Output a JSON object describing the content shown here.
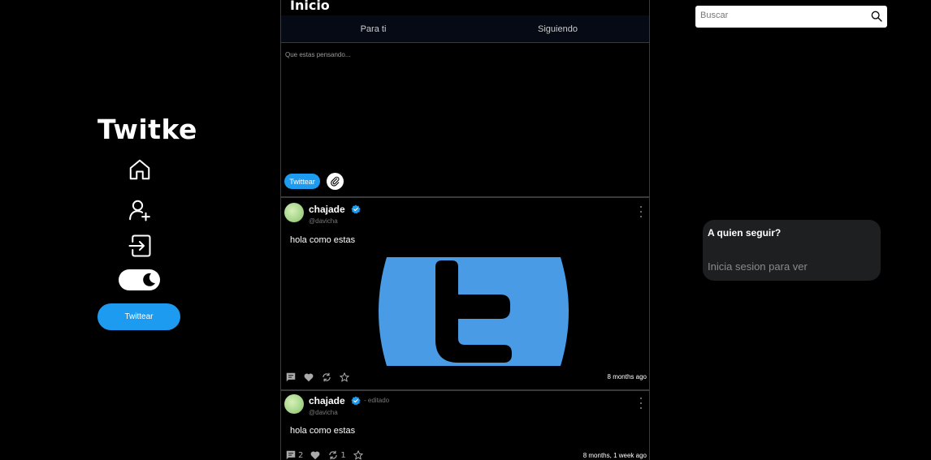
{
  "nav": {
    "brand": "Twitke",
    "tweet_button": "Twittear",
    "icons": [
      "home-icon",
      "add-user-icon",
      "login-icon",
      "theme-toggle"
    ]
  },
  "feed": {
    "title": "Inicio",
    "tabs": [
      {
        "label": "Para ti"
      },
      {
        "label": "Siguiendo"
      }
    ],
    "composer": {
      "placeholder": "Que estas pensando...",
      "tweet_button": "Twittear"
    },
    "posts": [
      {
        "user": "chajade",
        "handle": "@davicha",
        "text": "hola como estas",
        "time": "8 months ago",
        "edited": "",
        "likes": "",
        "retweets": "",
        "comments": ""
      },
      {
        "user": "chajade",
        "handle": "@davicha",
        "edited": "- editado",
        "text": "hola como estas",
        "time": "8 months, 1 week ago",
        "comments": "2",
        "likes": "",
        "retweets": "1"
      }
    ]
  },
  "sidebar": {
    "search_placeholder": "Buscar",
    "follow": {
      "title": "A quien seguir?",
      "message": "Inicia sesion para ver"
    }
  },
  "colors": {
    "accent": "#1d9bf0",
    "logo_blue": "#4a9be6",
    "background": "#000000"
  }
}
